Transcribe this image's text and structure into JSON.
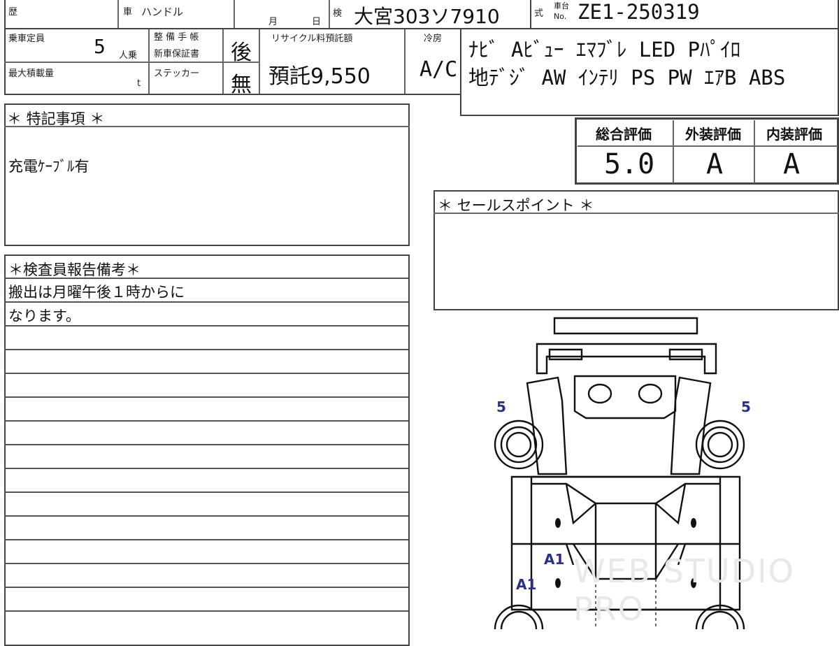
{
  "header": {
    "history_label": "歴",
    "steering_label": "車",
    "steering_value": "ハンドル",
    "month_label": "月",
    "day_label": "日",
    "inspection_label": "検",
    "plate": "大宮303ソ7910",
    "model_label": "式",
    "chassis_label": "車台",
    "chassis_no_label": "No.",
    "chassis_no": "ZE1-250319"
  },
  "specs": {
    "capacity_label": "乗車定員",
    "capacity_value": "5",
    "capacity_unit": "人乗",
    "max_load_label": "最大積載量",
    "max_load_unit": "t",
    "maintenance_label_1": "整 備 手 帳",
    "maintenance_label_2": "新車保証書",
    "maintenance_value": "後",
    "sticker_label": "ステッカー",
    "sticker_value": "無",
    "recycle_label": "リサイクル料預託額",
    "recycle_value": "預託9,550",
    "ac_label": "冷房",
    "ac_value": "A/C"
  },
  "equipment": {
    "line1": "ﾅﾋﾞ Aﾋﾞｭｰ ｴﾏﾌﾞﾚ LED Pﾊﾟｲﾛ",
    "line2": "地ﾃﾞｼﾞ AW ｲﾝﾃﾘ PS PW ｴｱB ABS"
  },
  "ratings": {
    "overall_label": "総合評価",
    "overall_value": "5.0",
    "exterior_label": "外装評価",
    "exterior_value": "A",
    "interior_label": "内装評価",
    "interior_value": "A"
  },
  "special_notes": {
    "title": "＊ 特記事項 ＊",
    "text": "充電ｹｰﾌﾞﾙ有"
  },
  "sales_points": {
    "title": "＊ セールスポイント ＊",
    "text": ""
  },
  "inspector_notes": {
    "title": "＊検査員報告備考＊",
    "line1": "搬出は月曜午後１時からに",
    "line2": "なります。"
  },
  "diagram_marks": {
    "left_wheel": "5",
    "right_wheel": "5",
    "mark_a": "A1",
    "mark_b": "A1"
  },
  "watermark": "WEB STUDIO PRO"
}
